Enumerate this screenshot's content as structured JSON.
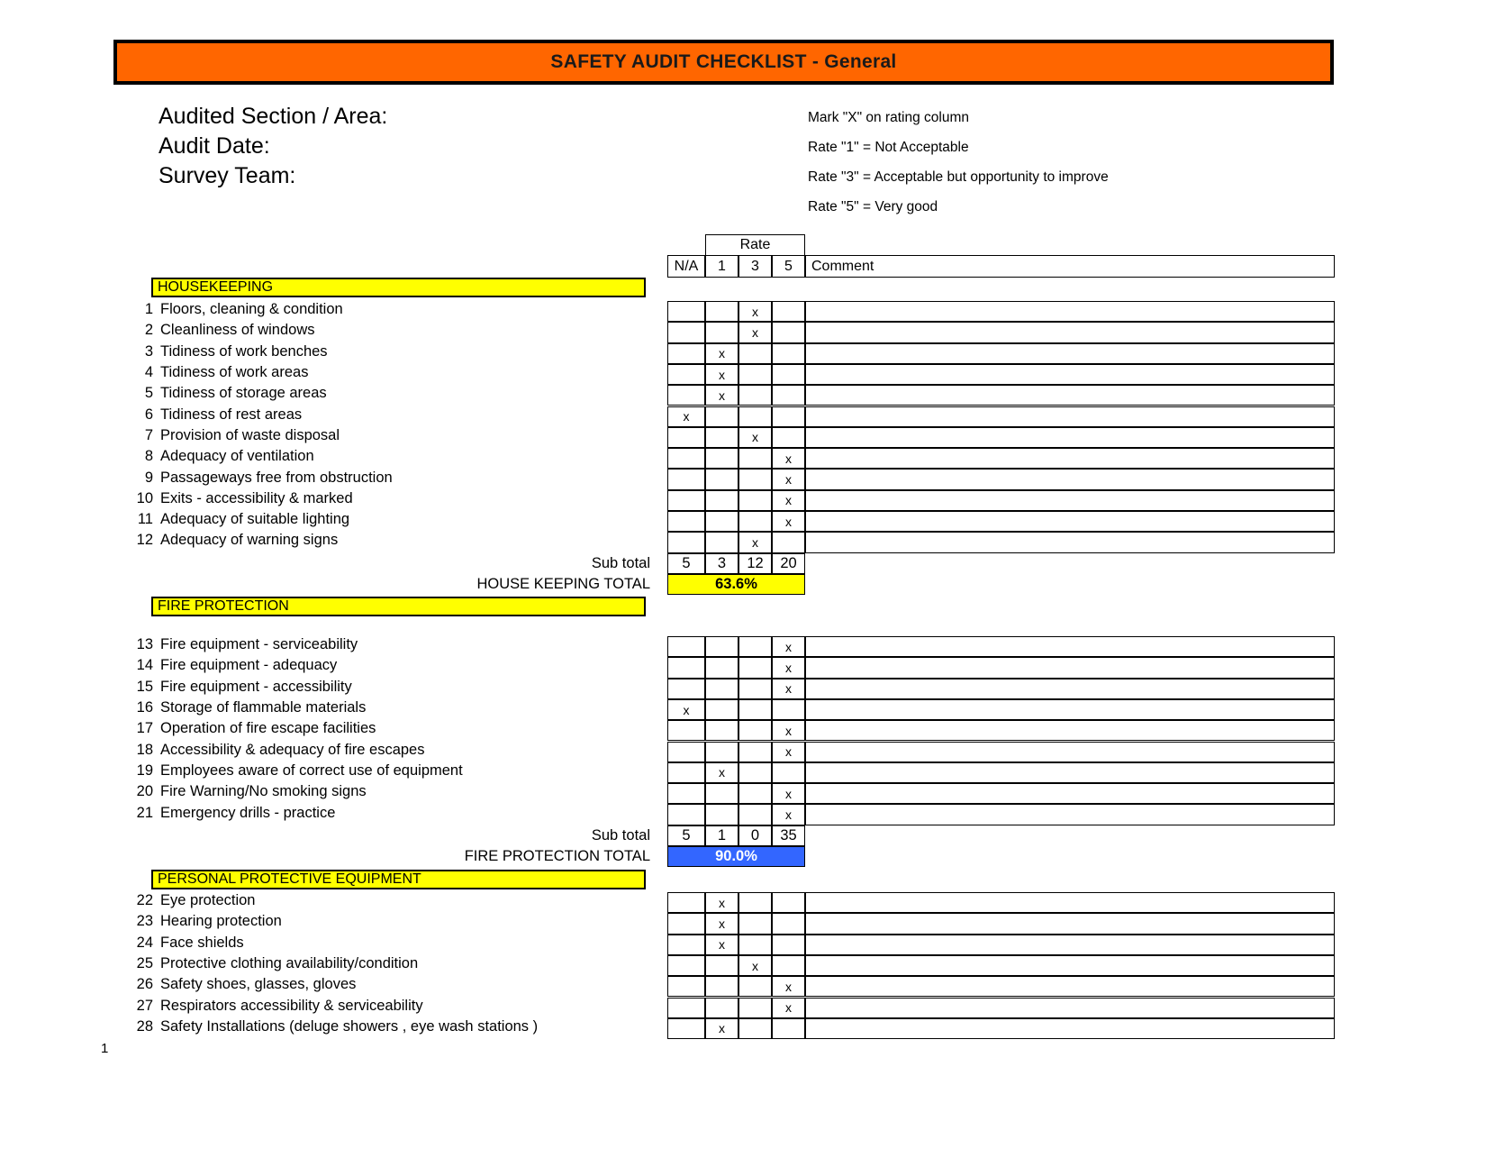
{
  "document": {
    "title": "SAFETY AUDIT CHECKLIST - General",
    "banner_color": "#FF6600",
    "page_number": "1"
  },
  "fields": [
    {
      "label": "Audited Section / Area:",
      "value": ""
    },
    {
      "label": "Audit Date:",
      "value": ""
    },
    {
      "label": "Survey Team:",
      "value": ""
    }
  ],
  "legend": [
    "Mark \"X\" on rating column",
    "Rate \"1\" = Not Acceptable",
    "Rate \"3\" = Acceptable but opportunity to improve",
    "Rate \"5\" = Very good"
  ],
  "table_header": {
    "rate_group": "Rate",
    "na": "N/A",
    "rate_1": "1",
    "rate_3": "3",
    "rate_5": "5",
    "comment": "Comment"
  },
  "labels": {
    "sub_total": "Sub total"
  },
  "sections": [
    {
      "id": "housekeeping",
      "name": "HOUSEKEEPING",
      "header_color": "#FFFF00",
      "items": [
        {
          "num": "1",
          "text": "Floors, cleaning & condition",
          "mark": "3",
          "comment": ""
        },
        {
          "num": "2",
          "text": "Cleanliness of windows",
          "mark": "3",
          "comment": ""
        },
        {
          "num": "3",
          "text": "Tidiness of work benches",
          "mark": "1",
          "comment": ""
        },
        {
          "num": "4",
          "text": "Tidiness of work areas",
          "mark": "1",
          "comment": ""
        },
        {
          "num": "5",
          "text": "Tidiness of storage areas",
          "mark": "1",
          "comment": ""
        },
        {
          "num": "6",
          "text": "Tidiness of rest areas",
          "mark": "na",
          "comment": ""
        },
        {
          "num": "7",
          "text": "Provision of waste disposal",
          "mark": "3",
          "comment": ""
        },
        {
          "num": "8",
          "text": "Adequacy of ventilation",
          "mark": "5",
          "comment": ""
        },
        {
          "num": "9",
          "text": "Passageways free from obstruction",
          "mark": "5",
          "comment": ""
        },
        {
          "num": "10",
          "text": "Exits - accessibility & marked",
          "mark": "5",
          "comment": ""
        },
        {
          "num": "11",
          "text": "Adequacy of suitable lighting",
          "mark": "5",
          "comment": ""
        },
        {
          "num": "12",
          "text": "Adequacy of warning signs",
          "mark": "3",
          "comment": ""
        }
      ],
      "subtotal": {
        "na": "5",
        "r1": "3",
        "r3": "12",
        "r5": "20"
      },
      "total_label": "HOUSE KEEPING TOTAL",
      "total_value": "63.6%",
      "total_bg": "#FFFF00",
      "total_fg": "#000000"
    },
    {
      "id": "fire-protection",
      "name": "FIRE PROTECTION",
      "header_color": "#FFFF00",
      "items": [
        {
          "num": "13",
          "text": "Fire equipment - serviceability",
          "mark": "5",
          "comment": ""
        },
        {
          "num": "14",
          "text": "Fire equipment - adequacy",
          "mark": "5",
          "comment": ""
        },
        {
          "num": "15",
          "text": "Fire equipment - accessibility",
          "mark": "5",
          "comment": ""
        },
        {
          "num": "16",
          "text": "Storage of flammable materials",
          "mark": "na",
          "comment": ""
        },
        {
          "num": "17",
          "text": "Operation of fire escape facilities",
          "mark": "5",
          "comment": ""
        },
        {
          "num": "18",
          "text": "Accessibility & adequacy of fire escapes",
          "mark": "5",
          "comment": ""
        },
        {
          "num": "19",
          "text": "Employees aware of correct use of equipment",
          "mark": "1",
          "comment": ""
        },
        {
          "num": "20",
          "text": "Fire Warning/No smoking signs",
          "mark": "5",
          "comment": ""
        },
        {
          "num": "21",
          "text": "Emergency drills - practice",
          "mark": "5",
          "comment": ""
        }
      ],
      "subtotal": {
        "na": "5",
        "r1": "1",
        "r3": "0",
        "r5": "35"
      },
      "total_label": "FIRE PROTECTION TOTAL",
      "total_value": "90.0%",
      "total_bg": "#3366FF",
      "total_fg": "#FFFFFF"
    },
    {
      "id": "ppe",
      "name": "PERSONAL PROTECTIVE EQUIPMENT",
      "header_color": "#FFFF00",
      "items": [
        {
          "num": "22",
          "text": "Eye protection",
          "mark": "1",
          "comment": ""
        },
        {
          "num": "23",
          "text": "Hearing protection",
          "mark": "1",
          "comment": ""
        },
        {
          "num": "24",
          "text": "Face shields",
          "mark": "1",
          "comment": ""
        },
        {
          "num": "25",
          "text": "Protective clothing availability/condition",
          "mark": "3",
          "comment": ""
        },
        {
          "num": "26",
          "text": "Safety shoes, glasses, gloves",
          "mark": "5",
          "comment": ""
        },
        {
          "num": "27",
          "text": "Respirators accessibility & serviceability",
          "mark": "5",
          "comment": ""
        },
        {
          "num": "28",
          "text": "Safety Installations (deluge showers , eye wash stations )",
          "mark": "1",
          "comment": ""
        }
      ],
      "subtotal": null,
      "total_label": null,
      "total_value": null
    }
  ],
  "mark_glyph": "x"
}
